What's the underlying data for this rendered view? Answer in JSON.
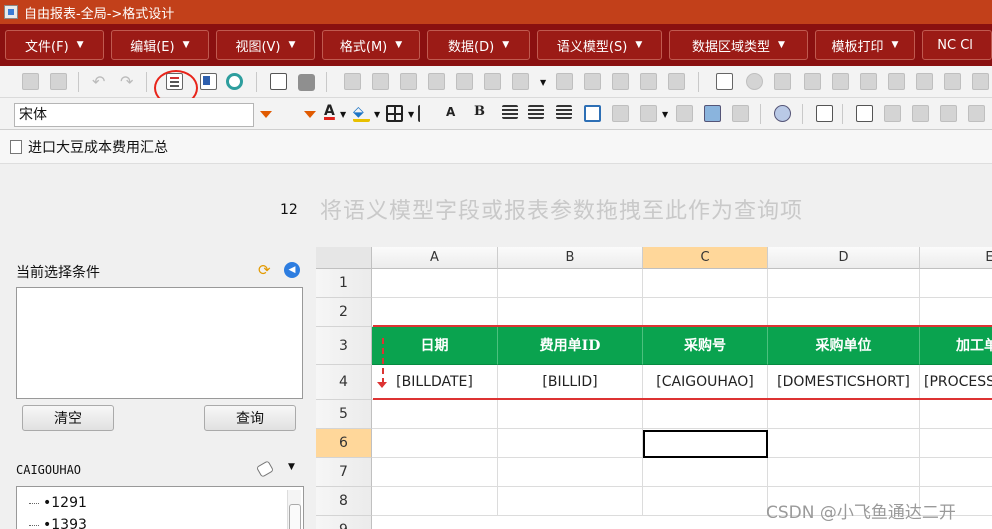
{
  "window": {
    "title": "自由报表-全局->格式设计"
  },
  "menu": [
    {
      "label": "文件(F)"
    },
    {
      "label": "编辑(E)"
    },
    {
      "label": "视图(V)"
    },
    {
      "label": "格式(M)"
    },
    {
      "label": "数据(D)"
    },
    {
      "label": "语义模型(S)"
    },
    {
      "label": "数据区域类型"
    },
    {
      "label": "模板打印"
    },
    {
      "label": "NC Cl"
    }
  ],
  "format_toolbar": {
    "font": "宋体",
    "size": "12",
    "bold": "B",
    "grow": "A"
  },
  "report_tab": {
    "label": "进口大豆成本费用汇总"
  },
  "query_hint": "将语义模型字段或报表参数拖拽至此作为查询项",
  "conditions": {
    "label": "当前选择条件",
    "clear_label": "清空",
    "query_label": "查询"
  },
  "field_panel": {
    "field": "CAIGOUHAO",
    "items": [
      "1291",
      "1393"
    ]
  },
  "grid": {
    "columns": [
      "A",
      "B",
      "C",
      "D",
      "E"
    ],
    "rows": [
      "1",
      "2",
      "3",
      "4",
      "5",
      "6",
      "7",
      "8",
      "9"
    ],
    "header_row": [
      "日期",
      "费用单ID",
      "采购号",
      "采购单位",
      "加工单"
    ],
    "field_row": [
      "[BILLDATE]",
      "[BILLID]",
      "[CAIGOUHAO]",
      "[DOMESTICSHORT]",
      "[PROCESS"
    ],
    "selected_column": "C",
    "selected_row": "6",
    "header_color": "#0aa34f"
  },
  "watermark": "CSDN @小飞鱼通达二开"
}
